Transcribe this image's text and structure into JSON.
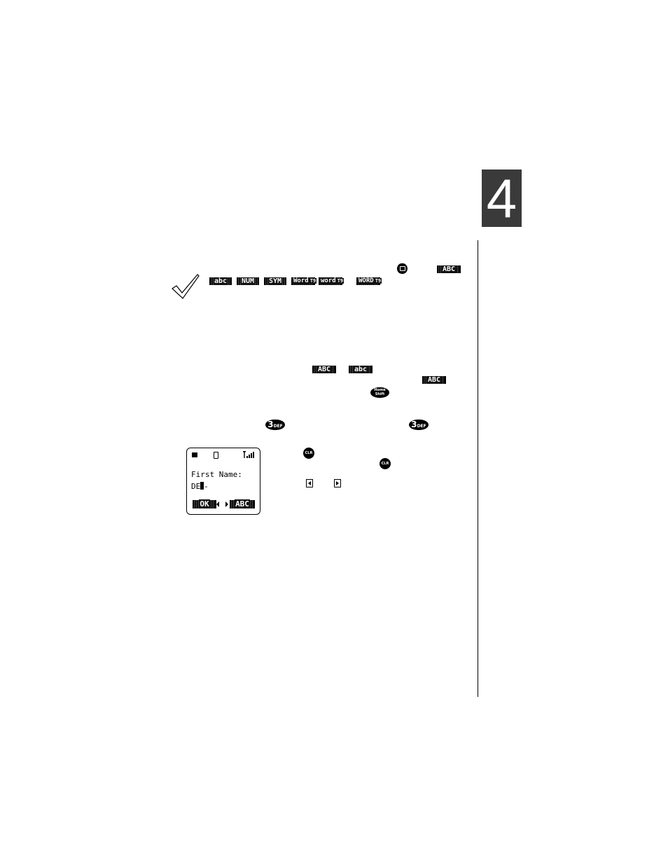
{
  "chapter": {
    "number": "4"
  },
  "note_row1": {
    "abc_upper": "ABC"
  },
  "note_row2": {
    "abc_lower": "abc",
    "num": "NUM",
    "sym": "SYM",
    "word1": "Word",
    "word2": "word",
    "word3": "WORD",
    "t9": "T9"
  },
  "case_row": {
    "abc_upper": "ABC",
    "abc_lower": "abc",
    "abc_upper2": "ABC"
  },
  "keys": {
    "home_shift_top": "Home",
    "home_shift_bottom": "Shift",
    "three_def_digit": "3",
    "three_def_letters": "DEF",
    "clr": "CLR"
  },
  "phone_screen": {
    "label": "First Name:",
    "entry": "DE",
    "softkey_left": "OK",
    "softkey_right": "ABC"
  },
  "icons": {
    "check": "checkmark-icon",
    "menu": "menu-key-icon",
    "battery": "battery-icon",
    "phone_status": "phone-status-icon",
    "signal": "signal-strength-icon",
    "left_arrow": "left-arrow-key-icon",
    "right_arrow": "right-arrow-key-icon"
  }
}
